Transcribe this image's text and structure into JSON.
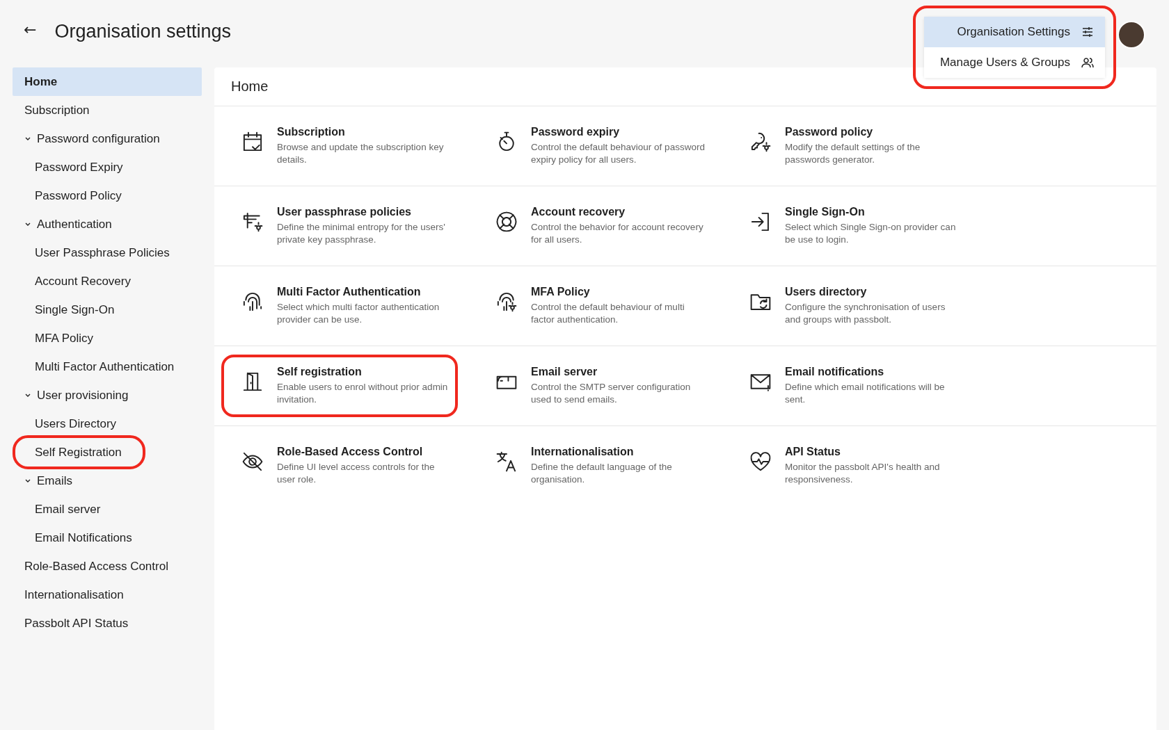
{
  "header": {
    "back": "←",
    "title": "Organisation settings"
  },
  "menu": {
    "highlighted": true,
    "items": [
      {
        "label": "Organisation Settings",
        "selected": true
      },
      {
        "label": "Manage Users & Groups",
        "selected": false
      }
    ]
  },
  "sidebar": {
    "items": [
      {
        "label": "Home",
        "selected": true
      },
      {
        "label": "Subscription",
        "selected": false
      },
      {
        "label": "Password configuration",
        "expanded": true,
        "children": [
          {
            "label": "Password Expiry",
            "selected": false,
            "highlighted": false
          },
          {
            "label": "Password Policy",
            "selected": false,
            "highlighted": false
          }
        ]
      },
      {
        "label": "Authentication",
        "expanded": true,
        "children": [
          {
            "label": "User Passphrase Policies",
            "selected": false,
            "highlighted": false
          },
          {
            "label": "Account Recovery",
            "selected": false,
            "highlighted": false
          },
          {
            "label": "Single Sign-On",
            "selected": false,
            "highlighted": false
          },
          {
            "label": "MFA Policy",
            "selected": false,
            "highlighted": false
          },
          {
            "label": "Multi Factor Authentication",
            "selected": false,
            "highlighted": false
          }
        ]
      },
      {
        "label": "User provisioning",
        "expanded": true,
        "children": [
          {
            "label": "Users Directory",
            "selected": false,
            "highlighted": false
          },
          {
            "label": "Self Registration",
            "selected": false,
            "highlighted": true
          }
        ]
      },
      {
        "label": "Emails",
        "expanded": true,
        "children": [
          {
            "label": "Email server",
            "selected": false,
            "highlighted": false
          },
          {
            "label": "Email Notifications",
            "selected": false,
            "highlighted": false
          }
        ]
      },
      {
        "label": "Role-Based Access Control",
        "selected": false
      },
      {
        "label": "Internationalisation",
        "selected": false
      },
      {
        "label": "Passbolt API Status",
        "selected": false
      }
    ]
  },
  "panel": {
    "title": "Home",
    "cards": [
      {
        "title": "Subscription",
        "description": "Browse and update the subscription key details.",
        "highlighted": false
      },
      {
        "title": "Password expiry",
        "description": "Control the default behaviour of password expiry policy for all users.",
        "highlighted": false
      },
      {
        "title": "Password policy",
        "description": "Modify the default settings of the passwords generator.",
        "highlighted": false
      },
      {
        "title": "User passphrase policies",
        "description": "Define the minimal entropy for the users' private key passphrase.",
        "highlighted": false
      },
      {
        "title": "Account recovery",
        "description": "Control the behavior for account recovery for all users.",
        "highlighted": false
      },
      {
        "title": "Single Sign-On",
        "description": "Select which Single Sign-on provider can be use to login.",
        "highlighted": false
      },
      {
        "title": "Multi Factor Authentication",
        "description": "Select which multi factor authentication provider can be use.",
        "highlighted": false
      },
      {
        "title": "MFA Policy",
        "description": "Control the default behaviour of multi factor authentication.",
        "highlighted": false
      },
      {
        "title": "Users directory",
        "description": "Configure the synchronisation of users and groups with passbolt.",
        "highlighted": false
      },
      {
        "title": "Self registration",
        "description": "Enable users to enrol without prior admin invitation.",
        "highlighted": true
      },
      {
        "title": "Email server",
        "description": "Control the SMTP server configuration used to send emails.",
        "highlighted": false
      },
      {
        "title": "Email notifications",
        "description": "Define which email notifications will be sent.",
        "highlighted": false
      },
      {
        "title": "Role-Based Access Control",
        "description": "Define UI level access controls for the user role.",
        "highlighted": false
      },
      {
        "title": "Internationalisation",
        "description": "Define the default language of the organisation.",
        "highlighted": false
      },
      {
        "title": "API Status",
        "description": "Monitor the passbolt API's health and responsiveness.",
        "highlighted": false
      }
    ]
  }
}
